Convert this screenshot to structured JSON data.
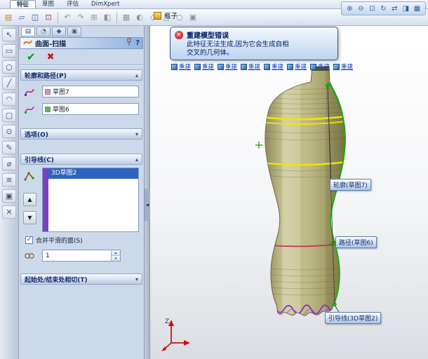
{
  "tabs": {
    "features": "特征",
    "sketch": "草图",
    "evaluate": "评估",
    "dimxpert": "DimXpert"
  },
  "document": {
    "part_name": "瓶子"
  },
  "panel": {
    "title": "曲面-扫描",
    "sections": {
      "profile_path": "轮廓和路径(P)",
      "options": "选项(O)",
      "guide": "引导线(C)",
      "tangency": "起始处/结束处相切(T)"
    },
    "profile_value": "草图7",
    "path_value": "草图6",
    "guide_items": [
      "3D草图2"
    ],
    "merge_label": "合并平滑的面(S)",
    "merge_checked": true,
    "influence_value": "1"
  },
  "viewport": {
    "error": {
      "title": "重建模型错误",
      "line1": "此特征无法生成,因为它会生成自相",
      "line2": "交叉的几何体。"
    },
    "rebuild_buttons": [
      "重建",
      "重建",
      "重建",
      "重建",
      "重建",
      "重建",
      "重建",
      "重建"
    ],
    "labels": {
      "profile": "轮廓(草图7)",
      "path": "路径(草图6)",
      "guide": "引导线(3D草图2)"
    },
    "triad": {
      "z": "Z"
    }
  },
  "icons": {
    "ok": "✔",
    "cancel": "✖",
    "error": "✕",
    "check": "✓",
    "help": "?",
    "chev_up": "▴",
    "chev_down": "▾",
    "up": "▲",
    "down": "▼",
    "spin_up": "▴",
    "spin_down": "▾",
    "collapse": "◀",
    "view": [
      "⊕",
      "⊖",
      "⊡",
      "↻",
      "⇄",
      "◨",
      "▦"
    ],
    "pm_tabs": [
      "▤",
      "◔",
      "◆",
      "▣"
    ],
    "toolbar": [
      "▤",
      "▱",
      "◫",
      "⊡",
      "↶",
      "↷",
      "⊞",
      "◧",
      "▦",
      "◐",
      "◇",
      "△",
      "○",
      "▣"
    ],
    "left": [
      "↖",
      "▭",
      "○",
      "╱",
      "◠",
      "▢",
      "⊙",
      "✎",
      "⌀",
      "≋",
      "▣",
      "✕"
    ]
  },
  "colors": {
    "accent": "#2f62c0",
    "error": "#c01818",
    "bottle": "#bdb985",
    "guide_green": "#00b400",
    "section_yellow": "#f3e400",
    "path_magenta": "#c23068",
    "sketch_purple": "#7c2fc6"
  }
}
